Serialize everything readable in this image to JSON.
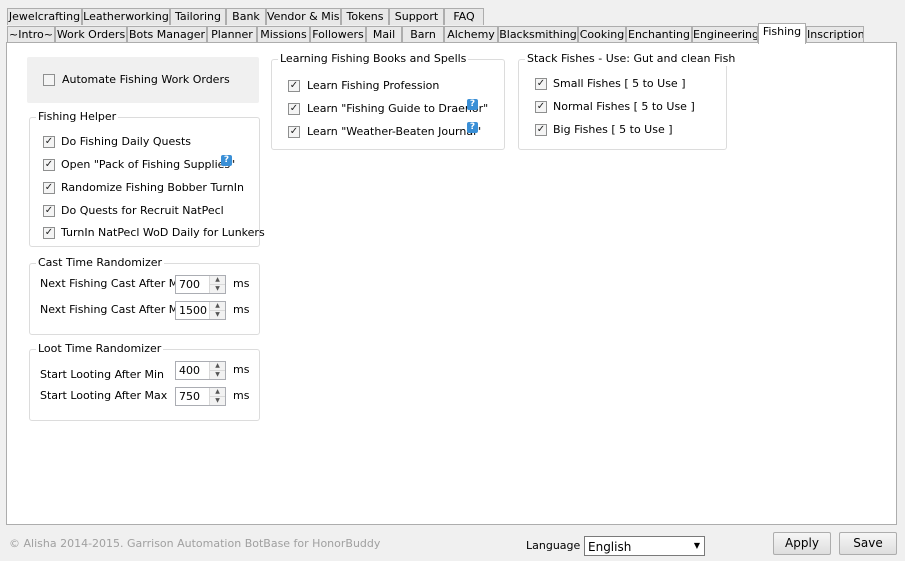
{
  "tabs_row1": [
    "Jewelcrafting",
    "Leatherworking",
    "Tailoring",
    "Bank",
    "Vendor & Misc",
    "Tokens",
    "Support",
    "FAQ"
  ],
  "tabs_row2": [
    "~Intro~",
    "Work Orders",
    "Bots Manager",
    "Planner",
    "Missions",
    "Followers",
    "Mail",
    "Barn",
    "Alchemy",
    "Blacksmithing",
    "Cooking",
    "Enchanting",
    "Engineering",
    "Fishing",
    "Inscription"
  ],
  "active_tab": "Fishing",
  "automate": {
    "label": "Automate Fishing Work Orders",
    "checked": false
  },
  "fishing_helper": {
    "title": "Fishing Helper",
    "items": [
      {
        "label": "Do Fishing Daily Quests",
        "checked": true
      },
      {
        "label": "Open \"Pack of Fishing Supplies\"",
        "checked": true
      },
      {
        "label": "Randomize Fishing Bobber TurnIn",
        "checked": true
      },
      {
        "label": "Do Quests for Recruit NatPecl",
        "checked": true
      },
      {
        "label": "TurnIn NatPecl WoD Daily for Lunkers",
        "checked": true
      }
    ]
  },
  "cast_time": {
    "title": "Cast Time Randomizer",
    "min_label": "Next Fishing Cast After Min",
    "min_value": "700",
    "max_label": "Next Fishing Cast After Max",
    "max_value": "1500",
    "unit": "ms"
  },
  "loot_time": {
    "title": "Loot Time Randomizer",
    "min_label": "Start Looting After Min",
    "min_value": "400",
    "max_label": "Start Looting After Max",
    "max_value": "750",
    "unit": "ms"
  },
  "books": {
    "title": "Learning Fishing Books and Spells",
    "items": [
      {
        "label": "Learn Fishing Profession",
        "checked": true
      },
      {
        "label": "Learn \"Fishing Guide to Draenor\"",
        "checked": true
      },
      {
        "label": "Learn \"Weather-Beaten Journal\"",
        "checked": true
      }
    ]
  },
  "stack": {
    "title": "Stack Fishes - Use: Gut and clean Fish",
    "items": [
      {
        "label": "Small Fishes [ 5 to Use ]",
        "checked": true
      },
      {
        "label": "Normal Fishes [ 5 to Use ]",
        "checked": true
      },
      {
        "label": "Big Fishes [ 5 to Use ]",
        "checked": true
      }
    ]
  },
  "footer": {
    "copyright": "© Alisha 2014-2015. Garrison Automation BotBase for HonorBuddy",
    "language_label": "Language",
    "language_value": "English",
    "apply_label": "Apply",
    "save_label": "Save"
  },
  "icons": {
    "help": "help-icon",
    "check": "check-icon",
    "spinner_up": "spinner-up-icon",
    "spinner_down": "spinner-down-icon",
    "dropdown": "dropdown-arrow-icon"
  },
  "help_glyph": "?",
  "check_glyph": "✓",
  "colors": {
    "help_icon": "#3a8fd6",
    "panel_bg": "#ffffff",
    "window_bg": "#f0f0f0",
    "footer_text": "#a0a0a0"
  }
}
